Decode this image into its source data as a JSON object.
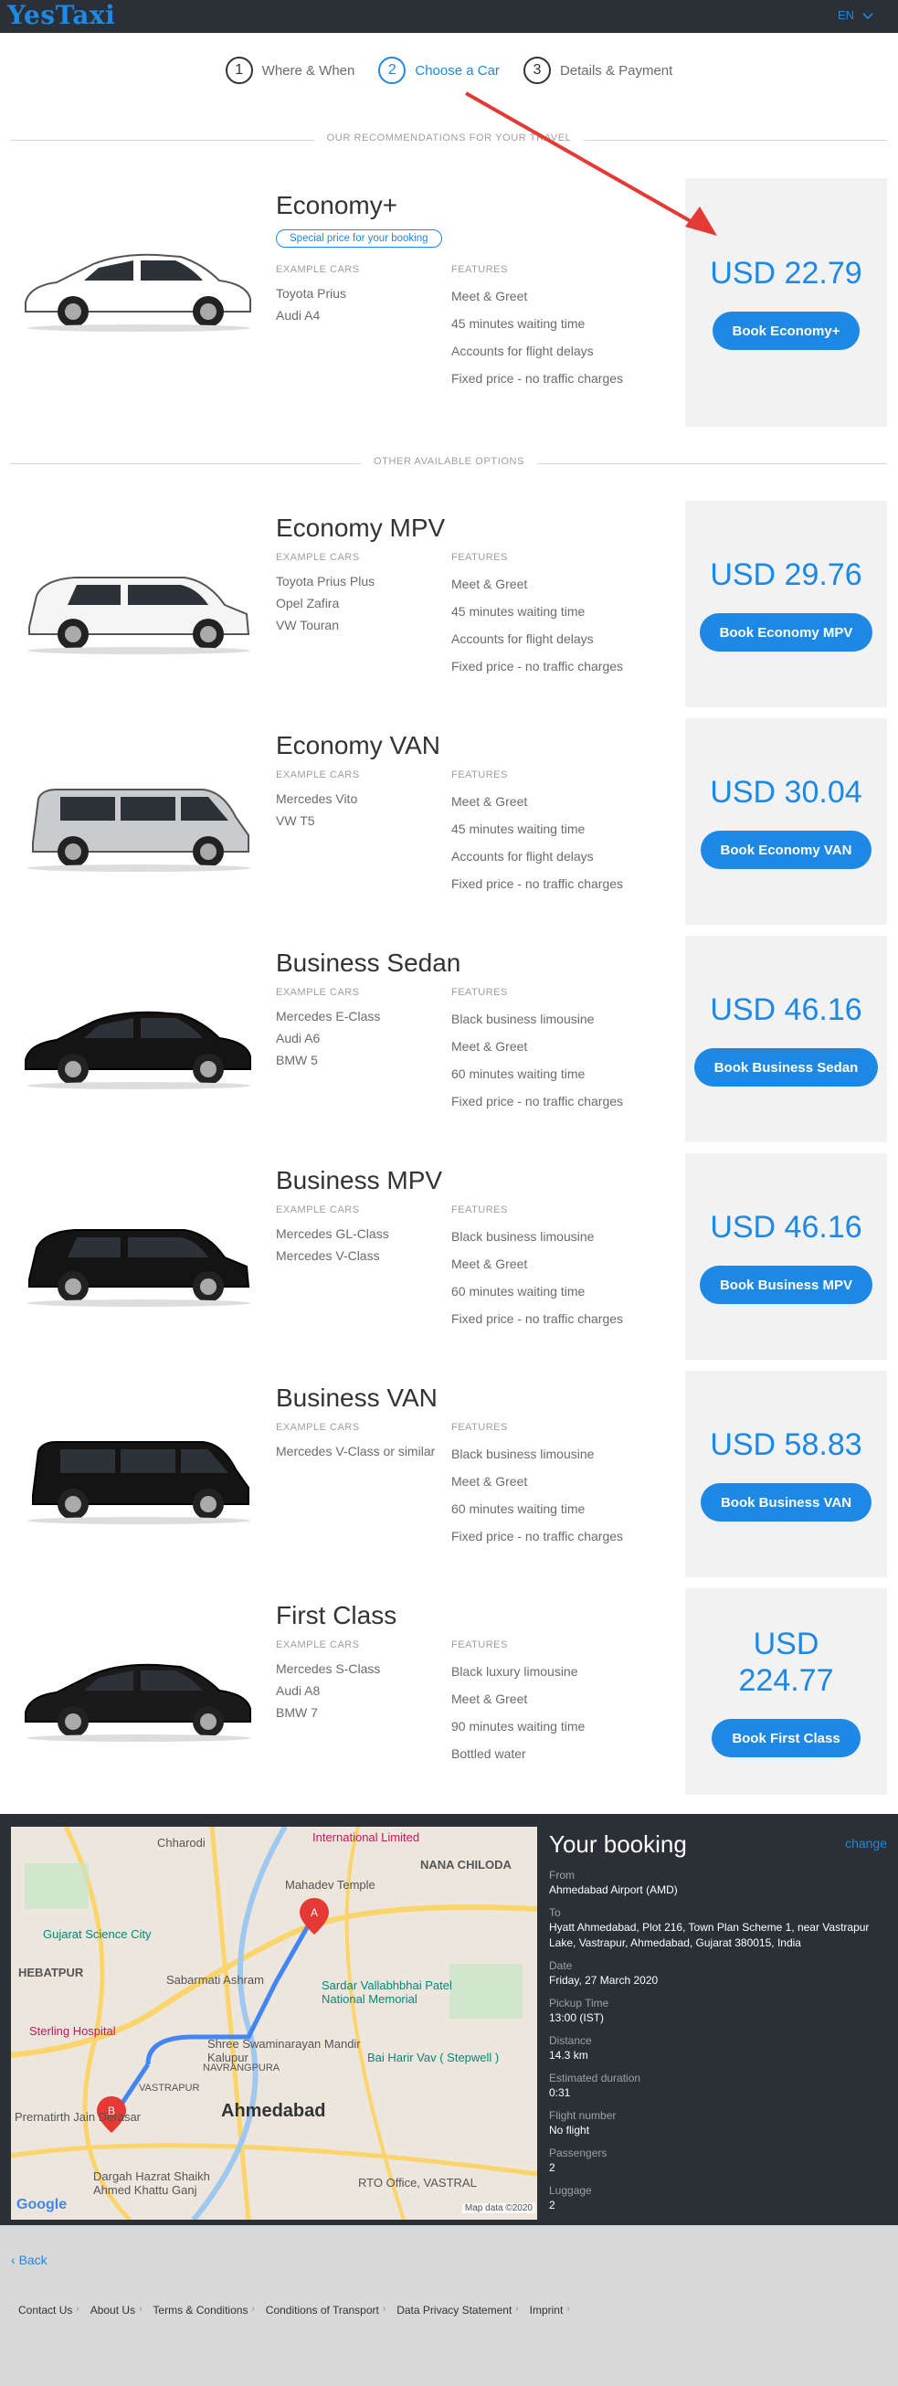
{
  "header": {
    "logo": "YesTaxi",
    "logo_sub": "ɾɞ♥ X",
    "language": "EN"
  },
  "steps": [
    {
      "num": "1",
      "label": "Where & When"
    },
    {
      "num": "2",
      "label": "Choose a Car"
    },
    {
      "num": "3",
      "label": "Details & Payment"
    }
  ],
  "sections": {
    "recommendations": "OUR RECOMMENDATIONS FOR YOUR TRAVEL",
    "other": "OTHER AVAILABLE OPTIONS"
  },
  "labels": {
    "example_cars": "EXAMPLE CARS",
    "features": "FEATURES"
  },
  "cars": [
    {
      "title": "Economy+",
      "badge": "Special price for your booking",
      "examples": [
        "Toyota Prius",
        "Audi A4"
      ],
      "features": [
        "Meet & Greet",
        "45 minutes waiting time",
        "Accounts for flight delays",
        "Fixed price - no traffic charges"
      ],
      "price": "USD 22.79",
      "button": "Book Economy+",
      "color": "#ffffff"
    },
    {
      "title": "Economy MPV",
      "examples": [
        "Toyota Prius Plus",
        "Opel Zafira",
        "VW Touran"
      ],
      "features": [
        "Meet & Greet",
        "45 minutes waiting time",
        "Accounts for flight delays",
        "Fixed price - no traffic charges"
      ],
      "price": "USD 29.76",
      "button": "Book Economy MPV",
      "color": "#f5f5f5"
    },
    {
      "title": "Economy VAN",
      "examples": [
        "Mercedes Vito",
        "VW T5"
      ],
      "features": [
        "Meet & Greet",
        "45 minutes waiting time",
        "Accounts for flight delays",
        "Fixed price - no traffic charges"
      ],
      "price": "USD 30.04",
      "button": "Book Economy VAN",
      "color": "#c9cbcf"
    },
    {
      "title": "Business Sedan",
      "examples": [
        "Mercedes E-Class",
        "Audi A6",
        "BMW 5"
      ],
      "features": [
        "Black business limousine",
        "Meet & Greet",
        "60 minutes waiting time",
        "Fixed price - no traffic charges"
      ],
      "price": "USD 46.16",
      "button": "Book Business Sedan",
      "color": "#141414"
    },
    {
      "title": "Business MPV",
      "examples": [
        "Mercedes GL-Class",
        "Mercedes V-Class"
      ],
      "features": [
        "Black business limousine",
        "Meet & Greet",
        "60 minutes waiting time",
        "Fixed price - no traffic charges"
      ],
      "price": "USD 46.16",
      "button": "Book Business MPV",
      "color": "#141414"
    },
    {
      "title": "Business VAN",
      "examples": [
        "Mercedes V-Class or similar"
      ],
      "features": [
        "Black business limousine",
        "Meet & Greet",
        "60 minutes waiting time",
        "Fixed price - no traffic charges"
      ],
      "price": "USD 58.83",
      "button": "Book Business VAN",
      "color": "#141414"
    },
    {
      "title": "First Class",
      "examples": [
        "Mercedes S-Class",
        "Audi A8",
        "BMW 7"
      ],
      "features": [
        "Black luxury limousine",
        "Meet & Greet",
        "90 minutes waiting time",
        "Bottled water"
      ],
      "price": "USD 224.77",
      "button": "Book First Class",
      "color": "#1a1a1a"
    }
  ],
  "map": {
    "labels": [
      "Chharodi",
      "NANA CHILODA",
      "International Limited",
      "Gujarat Science City",
      "HEBATPUR",
      "Sabarmati Ashram",
      "Sardar Vallabhbhai Patel National Memorial",
      "Sterling Hospital",
      "Shree Swaminarayan Mandir Kalupur",
      "Bai Harir Vav ( Stepwell )",
      "Ahmedabad",
      "Prernatirth Jain Derasar",
      "Dargah Hazrat Shaikh Ahmed Khattu Ganj",
      "RTO Office, VASTRAL",
      "Mahadev Temple",
      "NAVRANGPURA",
      "VASTRAPUR"
    ],
    "google": "Google",
    "map_data": "Map data ©2020"
  },
  "booking": {
    "title": "Your booking",
    "change": "change",
    "fields": [
      {
        "label": "From",
        "value": "Ahmedabad Airport (AMD)"
      },
      {
        "label": "To",
        "value": "Hyatt Ahmedabad, Plot 216, Town Plan Scheme 1, near Vastrapur Lake, Vastrapur, Ahmedabad, Gujarat 380015, India"
      },
      {
        "label": "Date",
        "value": "Friday, 27 March 2020"
      },
      {
        "label": "Pickup Time",
        "value": "13:00 (IST)"
      },
      {
        "label": "Distance",
        "value": "14.3 km"
      },
      {
        "label": "Estimated duration",
        "value": "0:31"
      },
      {
        "label": "Flight number",
        "value": "No flight"
      },
      {
        "label": "Passengers",
        "value": "2"
      },
      {
        "label": "Luggage",
        "value": "2"
      }
    ]
  },
  "footer": {
    "back": "Back",
    "links": [
      "Contact Us",
      "About Us",
      "Terms & Conditions",
      "Conditions of Transport",
      "Data Privacy Statement",
      "Imprint"
    ]
  }
}
